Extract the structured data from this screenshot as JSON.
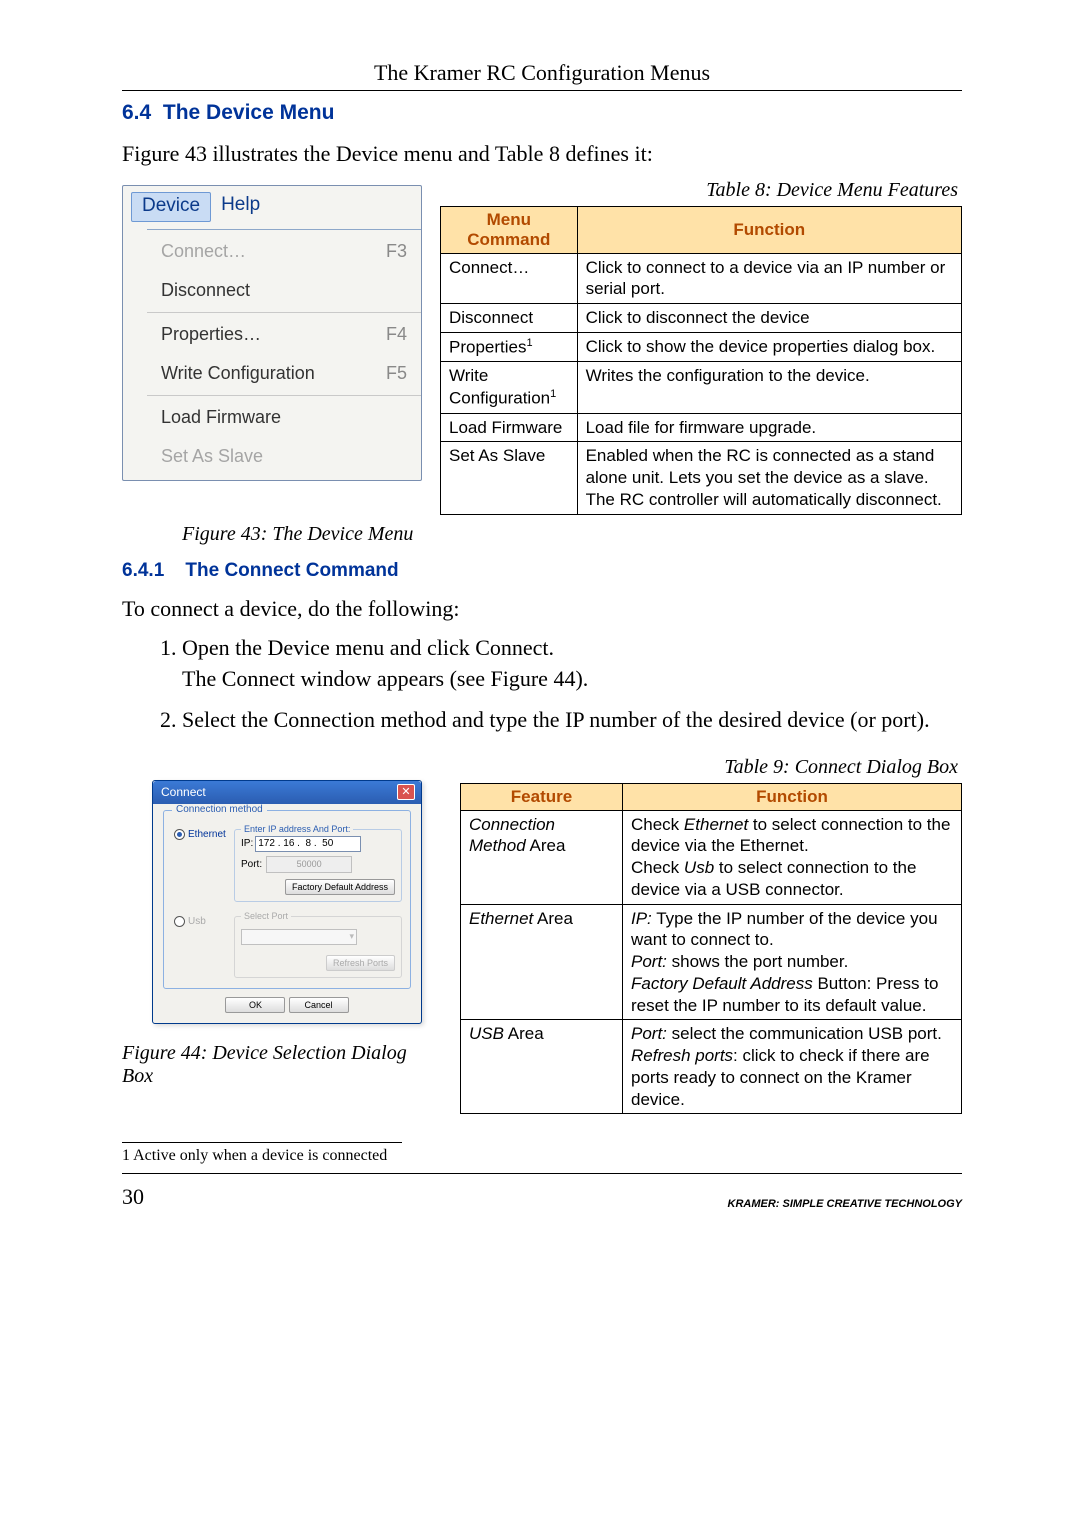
{
  "header": {
    "running_title": "The Kramer RC Configuration Menus"
  },
  "section": {
    "num": "6.4",
    "title": "The Device Menu",
    "intro": "Figure 43 illustrates the Device menu and Table 8 defines it:"
  },
  "fig43": {
    "caption": "Figure 43: The Device Menu",
    "menubar": {
      "device": "Device",
      "help": "Help"
    },
    "items": [
      {
        "label": "Connect…",
        "shortcut": "F3",
        "disabled": true
      },
      {
        "label": "Disconnect",
        "shortcut": "",
        "disabled": false
      },
      {
        "label": "Properties…",
        "shortcut": "F4",
        "disabled": false,
        "sep_before": true
      },
      {
        "label": "Write Configuration",
        "shortcut": "F5",
        "disabled": false
      },
      {
        "label": "Load Firmware",
        "shortcut": "",
        "disabled": false,
        "sep_before": true
      },
      {
        "label": "Set As Slave",
        "shortcut": "",
        "disabled": true
      }
    ]
  },
  "table8": {
    "caption": "Table 8: Device Menu Features",
    "head": [
      "Menu Command",
      "Function"
    ],
    "rows": [
      [
        "Connect…",
        "Click to connect to a device via an IP number or serial port."
      ],
      [
        "Disconnect",
        "Click to disconnect the device"
      ],
      [
        "Properties¹",
        "Click to show the device properties dialog box."
      ],
      [
        "Write Configuration¹",
        "Writes the configuration to the device."
      ],
      [
        "Load Firmware",
        "Load file for firmware upgrade."
      ],
      [
        "Set As Slave",
        "Enabled when the RC is connected as a stand alone unit. Lets you set the device as a slave. The RC controller will automatically disconnect."
      ]
    ]
  },
  "subsection": {
    "num": "6.4.1",
    "title": "The Connect Command",
    "para": "To connect a device, do the following:",
    "steps": [
      "Open the Device menu and click Connect. The Connect window appears (see Figure 44).",
      "Select the Connection method and type the IP number of the desired device (or port)."
    ]
  },
  "fig44": {
    "caption": "Figure 44: Device Selection Dialog Box",
    "window_title": "Connect",
    "group_label": "Connection method",
    "ethernet": {
      "radio": "Ethernet",
      "box_title": "Enter IP address And Port:",
      "ip_label": "IP:",
      "ip_value": "172 . 16 .  8 .  50",
      "port_label": "Port:",
      "port_value": "50000",
      "default_btn": "Factory Default Address"
    },
    "usb": {
      "radio": "Usb",
      "box_title": "Select Port",
      "refresh_btn": "Refresh Ports"
    },
    "ok": "OK",
    "cancel": "Cancel"
  },
  "table9": {
    "caption": "Table 9: Connect Dialog Box",
    "head": [
      "Feature",
      "Function"
    ],
    "rows": [
      {
        "feature_html": "<span class='ital'>Connection Method</span> Area",
        "func_html": "Check <span class='ital'>Ethernet</span> to select connection to the device via the Ethernet.<br>Check <span class='ital'>Usb</span> to select connection to the device via a USB connector."
      },
      {
        "feature_html": "<span class='ital'>Ethernet</span> Area",
        "func_html": "<span class='ital'>IP:</span> Type the IP number of the device you want to connect to.<br><span class='ital'>Port:</span> shows the port number.<br><span class='ital'>Factory Default Address</span> Button: Press to reset the IP number to its default value."
      },
      {
        "feature_html": "<span class='ital'>USB</span> Area",
        "func_html": "<span class='ital'>Port:</span> select the communication USB port.<br><span class='ital'>Refresh ports</span>: click to check if there are ports ready to connect on the Kramer device."
      }
    ]
  },
  "footnote": "1 Active only when a device is connected",
  "footer": {
    "page": "30",
    "tagline": "KRAMER:  SIMPLE CREATIVE TECHNOLOGY"
  }
}
